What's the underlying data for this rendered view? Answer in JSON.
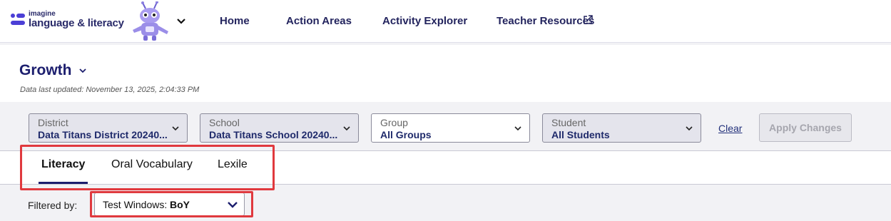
{
  "brand": {
    "logo_small": "imagine",
    "logo_big": "language & literacy",
    "brand_color": "#2a2b6a",
    "mascot_icon": "robot-mascot-icon"
  },
  "nav": {
    "links": [
      "Home",
      "Action Areas",
      "Activity Explorer",
      "Teacher Resources"
    ],
    "external_icon": "external-link-icon"
  },
  "page": {
    "title": "Growth",
    "last_updated": "Data last updated: November 13, 2025, 2:04:33 PM"
  },
  "filters": [
    {
      "label": "District",
      "value": "Data Titans District 20240...",
      "enabled": false
    },
    {
      "label": "School",
      "value": "Data Titans School 20240...",
      "enabled": false
    },
    {
      "label": "Group",
      "value": "All Groups",
      "enabled": true
    },
    {
      "label": "Student",
      "value": "All Students",
      "enabled": false
    }
  ],
  "actions": {
    "clear_label": "Clear",
    "apply_label": "Apply Changes"
  },
  "tabs": {
    "items": [
      "Literacy",
      "Oral Vocabulary",
      "Lexile"
    ],
    "active": "Literacy"
  },
  "filtered_by": {
    "label": "Filtered by:",
    "select_label": "Test Windows:",
    "select_value": "BoY"
  },
  "colors": {
    "accent": "#1c1e6e",
    "highlight": "#e0393e"
  }
}
